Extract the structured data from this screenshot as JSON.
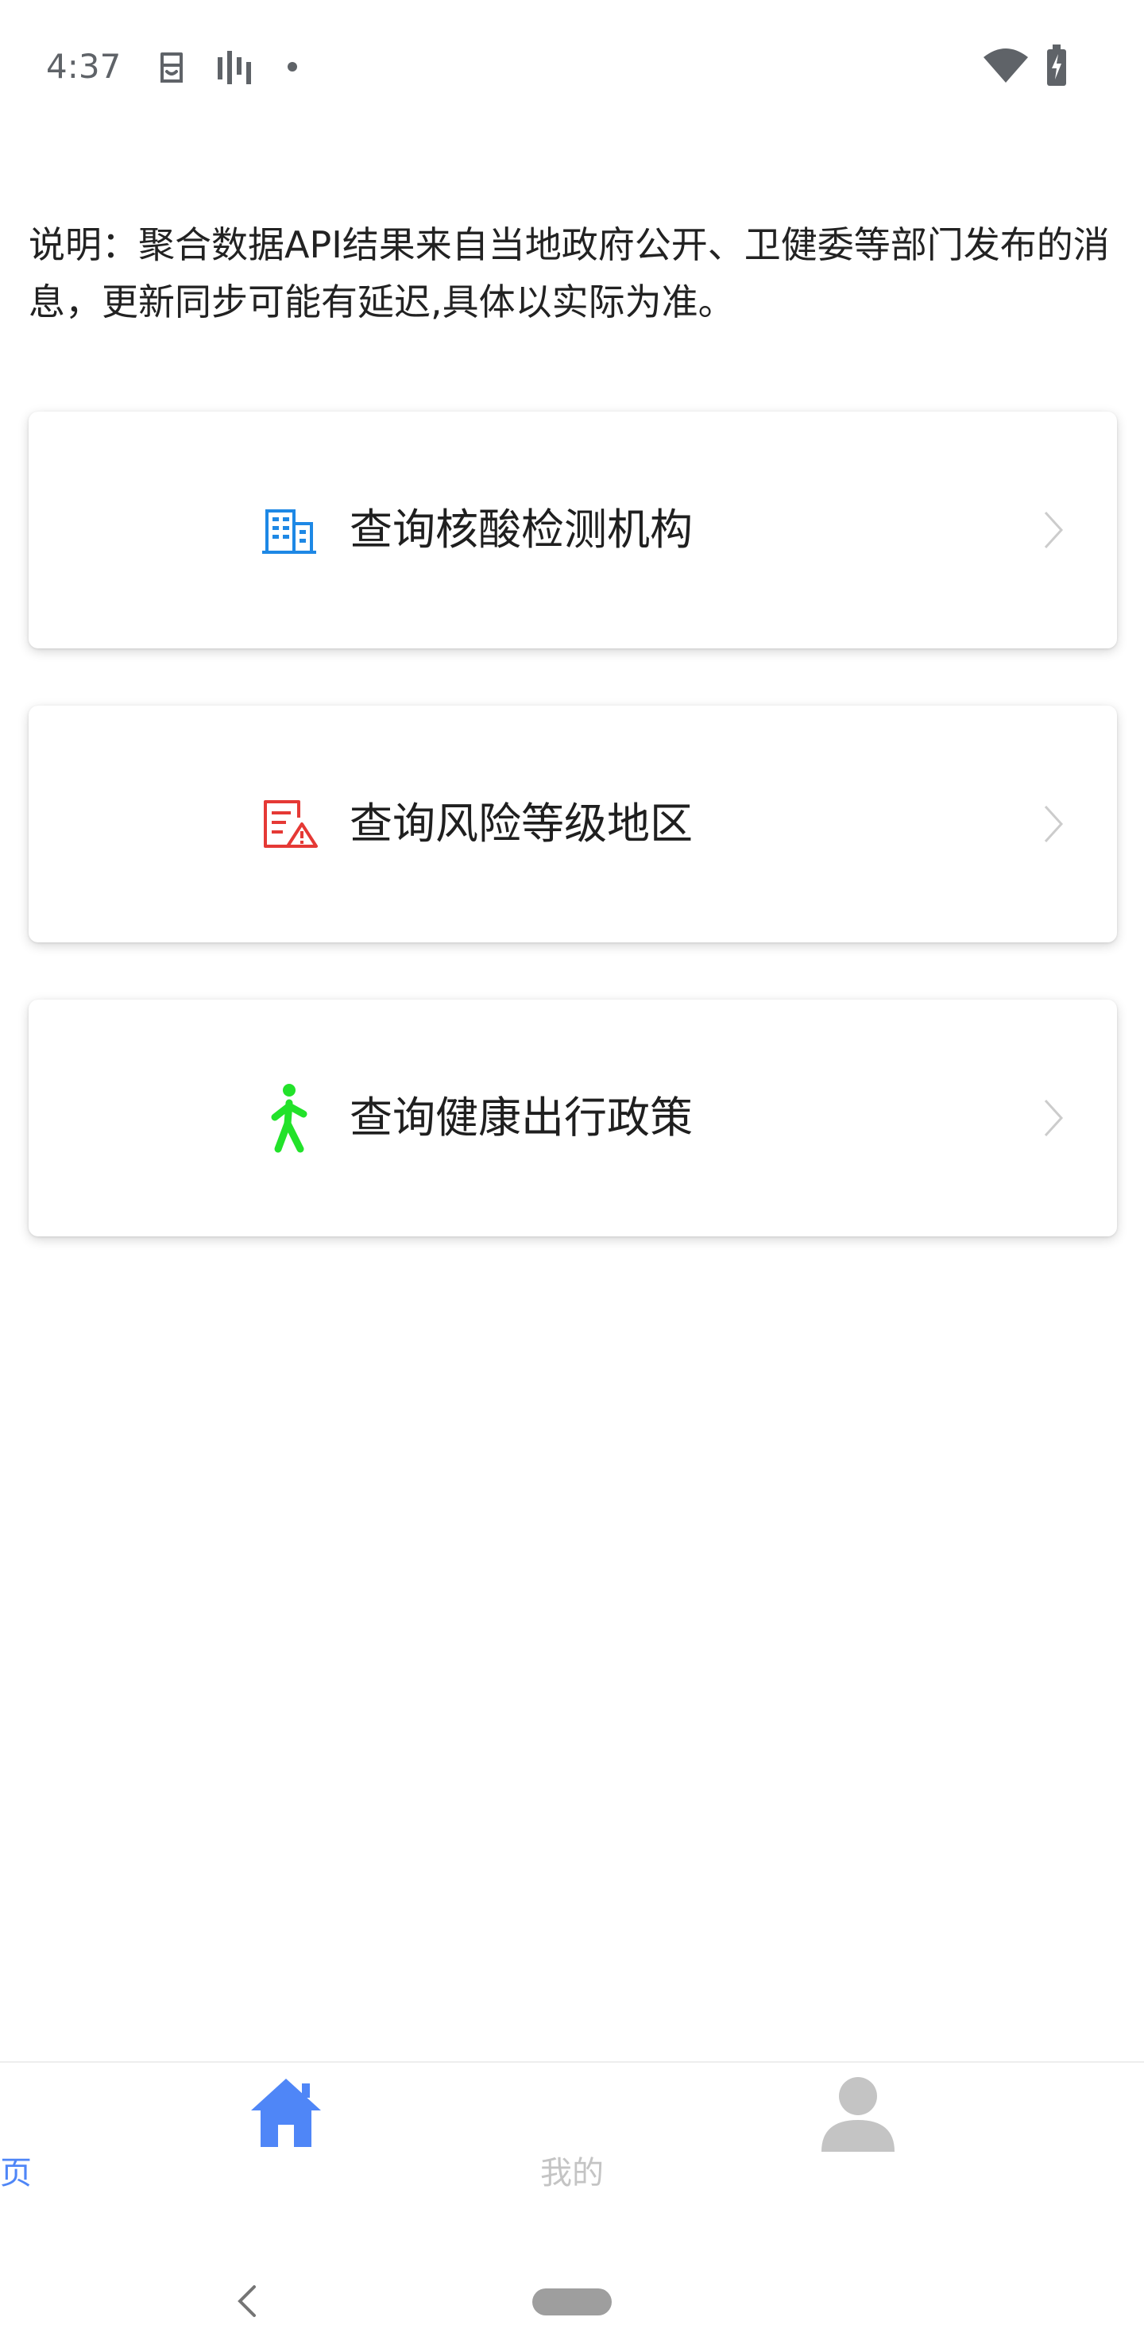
{
  "status_bar": {
    "time": "4:37",
    "icons": [
      "emoji-icon",
      "signal-bars-icon",
      "dot-icon",
      "wifi-icon",
      "battery-charging-icon"
    ]
  },
  "description": "说明：聚合数据API结果来自当地政府公开、卫健委等部门发布的消息，更新同步可能有延迟,具体以实际为准。",
  "cards": [
    {
      "label": "查询核酸检测机构",
      "icon": "building-icon",
      "icon_color": "#1e88e5"
    },
    {
      "label": "查询风险等级地区",
      "icon": "risk-document-icon",
      "icon_color": "#e53935"
    },
    {
      "label": "查询健康出行政策",
      "icon": "walking-person-icon",
      "icon_color": "#22e22a"
    }
  ],
  "tabs": [
    {
      "label": "首页",
      "icon": "home-icon",
      "active": true,
      "color": "#4f86f7"
    },
    {
      "label": "我的",
      "icon": "user-icon",
      "active": false,
      "color": "#c4c4c4"
    }
  ],
  "colors": {
    "accent": "#4f86f7",
    "inactive": "#c4c4c4",
    "chevron": "#cccccc"
  }
}
